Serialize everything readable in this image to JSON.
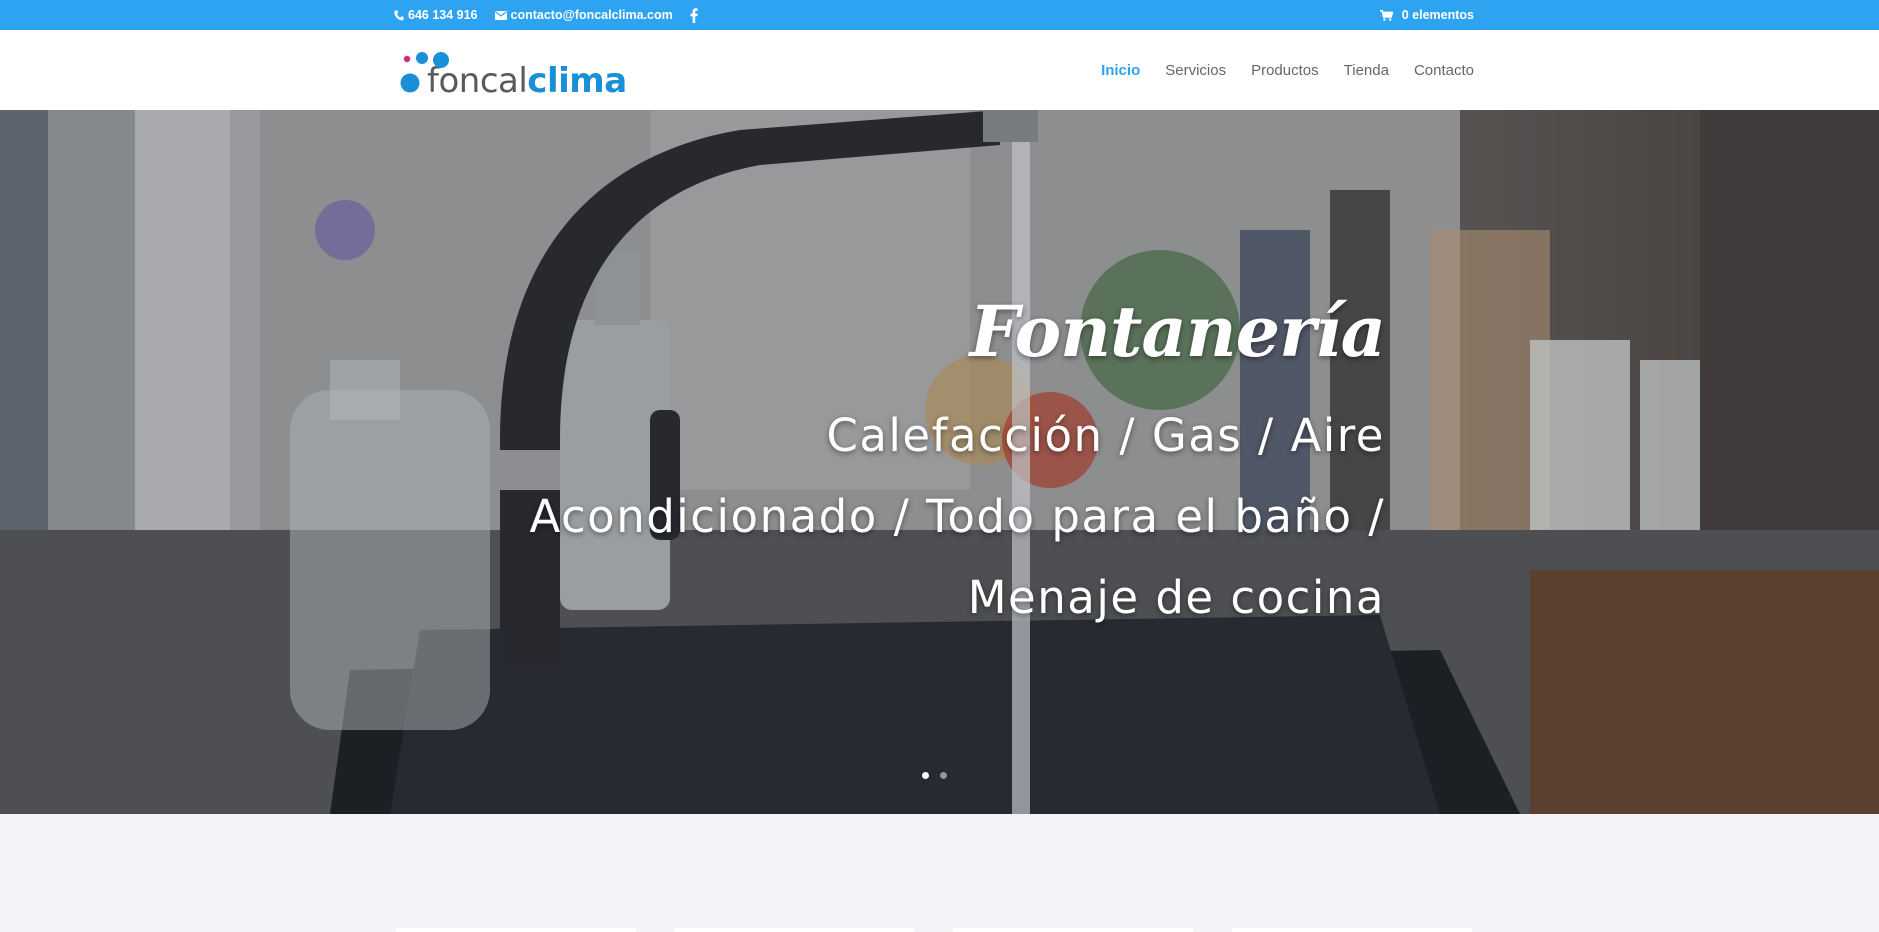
{
  "topbar": {
    "phone": "646 134 916",
    "email": "contacto@foncalclima.com",
    "cart_label": "0 elementos",
    "phone_icon": "phone-icon",
    "email_icon": "envelope-icon",
    "social_icon": "facebook-icon",
    "cart_icon": "cart-icon"
  },
  "logo": {
    "part1": "foncal",
    "part2": "clima"
  },
  "nav": {
    "items": [
      {
        "label": "Inicio",
        "active": true
      },
      {
        "label": "Servicios"
      },
      {
        "label": "Productos"
      },
      {
        "label": "Tienda"
      },
      {
        "label": "Contacto"
      }
    ]
  },
  "hero": {
    "title": "Fontanería",
    "line1": "Calefacción / Gas / Aire",
    "line2": "Acondicionado / Todo para el baño /",
    "line3": "Menaje de cocina",
    "slides_total": 2,
    "active_slide": 1
  },
  "colors": {
    "accent": "#2ea3f2",
    "logo_blue": "#1a8fd8",
    "logo_magenta": "#d6287a"
  }
}
